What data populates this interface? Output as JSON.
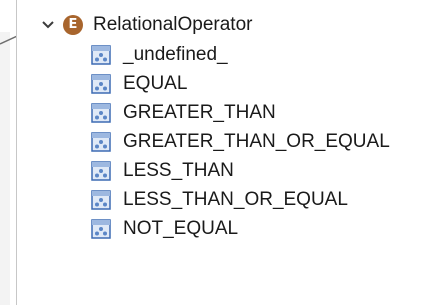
{
  "tree": {
    "root": {
      "label": "RelationalOperator",
      "icon": "enum-icon",
      "icon_letter": "E",
      "expanded": true
    },
    "children": [
      {
        "label": "_undefined_",
        "icon": "enum-literal-icon"
      },
      {
        "label": "EQUAL",
        "icon": "enum-literal-icon"
      },
      {
        "label": "GREATER_THAN",
        "icon": "enum-literal-icon"
      },
      {
        "label": "GREATER_THAN_OR_EQUAL",
        "icon": "enum-literal-icon"
      },
      {
        "label": "LESS_THAN",
        "icon": "enum-literal-icon"
      },
      {
        "label": "LESS_THAN_OR_EQUAL",
        "icon": "enum-literal-icon"
      },
      {
        "label": "NOT_EQUAL",
        "icon": "enum-literal-icon"
      }
    ]
  },
  "colors": {
    "enum_icon": "#a8652d",
    "literal_icon_border": "#3d6bb3",
    "literal_icon_fill": "#dfe9f7",
    "text": "#1a1a1a"
  }
}
